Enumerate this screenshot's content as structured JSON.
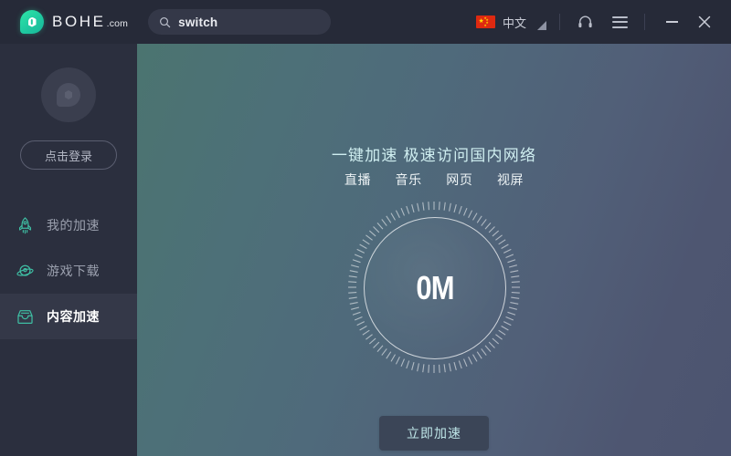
{
  "window": {
    "brand_name": "BOHE",
    "brand_suffix": ".com",
    "logo_icon": "shield-droplet-logo",
    "search": {
      "value": "switch",
      "placeholder": "switch",
      "icon": "search-icon"
    },
    "language": {
      "label": "中文",
      "flag": "china-flag-icon",
      "caret": "chevron-down-icon"
    },
    "support_icon": "headset-icon",
    "menu_icon": "hamburger-menu-icon",
    "minimize_icon": "minimize-icon",
    "close_icon": "close-icon"
  },
  "sidebar": {
    "avatar_icon": "user-avatar-placeholder",
    "login_label": "点击登录",
    "items": [
      {
        "label": "我的加速",
        "icon": "rocket-icon",
        "active": false
      },
      {
        "label": "游戏下载",
        "icon": "planet-icon",
        "active": false
      },
      {
        "label": "内容加速",
        "icon": "inbox-tray-icon",
        "active": true
      }
    ]
  },
  "main": {
    "headline": "一键加速 极速访问国内网络",
    "tags": [
      "直播",
      "音乐",
      "网页",
      "视屏"
    ],
    "gauge": {
      "value": "0M",
      "ticks": 96
    },
    "cta_label": "立即加速"
  },
  "colors": {
    "titlebar_bg": "#262a38",
    "sidebar_bg": "#2b2f3e",
    "sidebar_active_bg": "#343848",
    "accent_teal": "#2ee6a8",
    "headline": "#cfeef0",
    "cta_bg": "#3b4557",
    "cta_text": "#bfe6e8",
    "flag_red": "#de2910"
  }
}
